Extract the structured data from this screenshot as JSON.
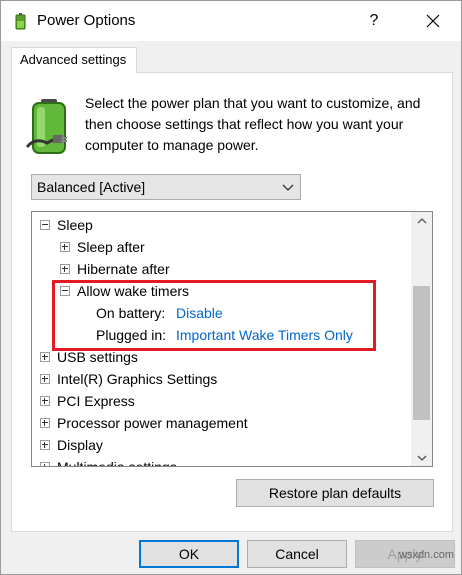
{
  "window": {
    "title": "Power Options",
    "help": "?"
  },
  "tab": {
    "label": "Advanced settings"
  },
  "description": "Select the power plan that you want to customize, and then choose settings that reflect how you want your computer to manage power.",
  "plan": {
    "selected": "Balanced [Active]"
  },
  "tree": {
    "sleep": "Sleep",
    "sleep_after": "Sleep after",
    "hibernate_after": "Hibernate after",
    "allow_wake_timers": "Allow wake timers",
    "on_battery_label": "On battery:",
    "on_battery_value": "Disable",
    "plugged_in_label": "Plugged in:",
    "plugged_in_value": "Important Wake Timers Only",
    "usb": "USB settings",
    "intel_graphics": "Intel(R) Graphics Settings",
    "pci": "PCI Express",
    "processor": "Processor power management",
    "display": "Display",
    "multimedia": "Multimedia settings"
  },
  "buttons": {
    "restore": "Restore plan defaults",
    "ok": "OK",
    "cancel": "Cancel",
    "apply": "Apply"
  },
  "watermark": "wsxdn.com",
  "colors": {
    "link": "#0066cc",
    "highlight": "#e01b24",
    "focus": "#0078d7"
  }
}
